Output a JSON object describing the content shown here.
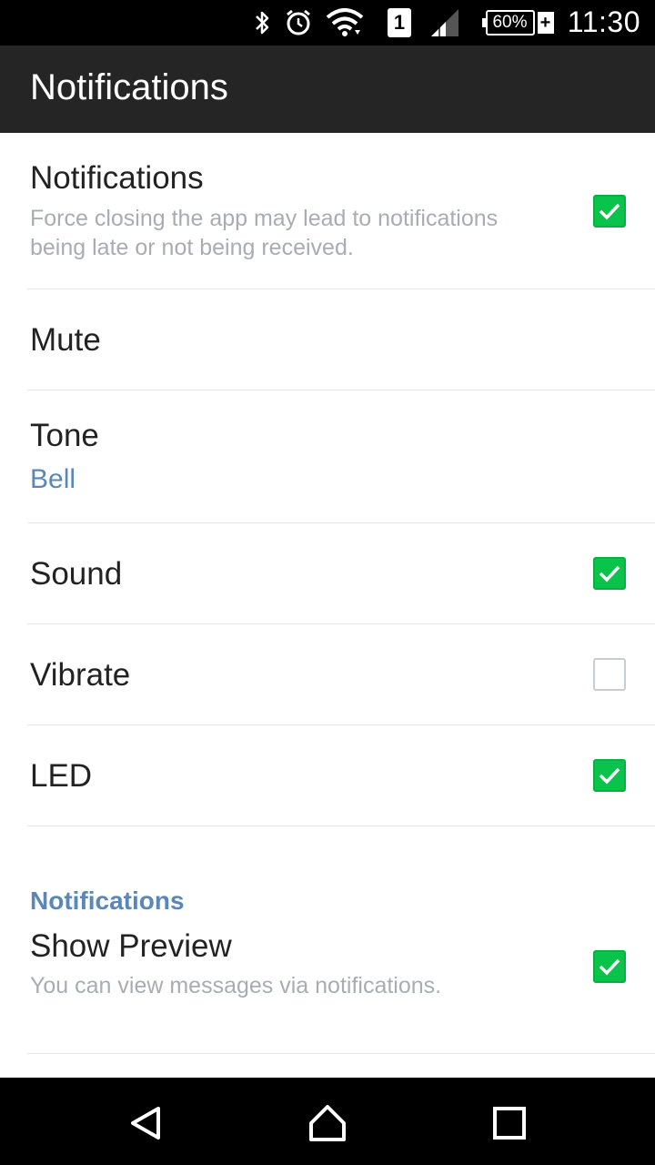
{
  "status_bar": {
    "icons": [
      "bluetooth-icon",
      "alarm-icon",
      "wifi-icon",
      "sim-icon",
      "signal-icon",
      "battery-icon"
    ],
    "sim_label": "1",
    "battery_percent": "60%",
    "battery_charging_symbol": "+",
    "time": "11:30"
  },
  "app_bar": {
    "title": "Notifications"
  },
  "settings": {
    "notifications": {
      "label": "Notifications",
      "summary": "Force closing the app may lead to notifications being late or not being received.",
      "checked": true
    },
    "mute": {
      "label": "Mute"
    },
    "tone": {
      "label": "Tone",
      "value": "Bell"
    },
    "sound": {
      "label": "Sound",
      "checked": true
    },
    "vibrate": {
      "label": "Vibrate",
      "checked": false
    },
    "led": {
      "label": "LED",
      "checked": true
    },
    "section_header": "Notifications",
    "show_preview": {
      "label": "Show Preview",
      "summary": "You can view messages via notifications.",
      "checked": true
    }
  },
  "nav_bar": {
    "icons": [
      "back-icon",
      "home-icon",
      "recents-icon"
    ]
  },
  "colors": {
    "accent": "#09c34b",
    "link": "#5b87b8",
    "app_bar": "#252525",
    "status_bar": "#000000"
  }
}
